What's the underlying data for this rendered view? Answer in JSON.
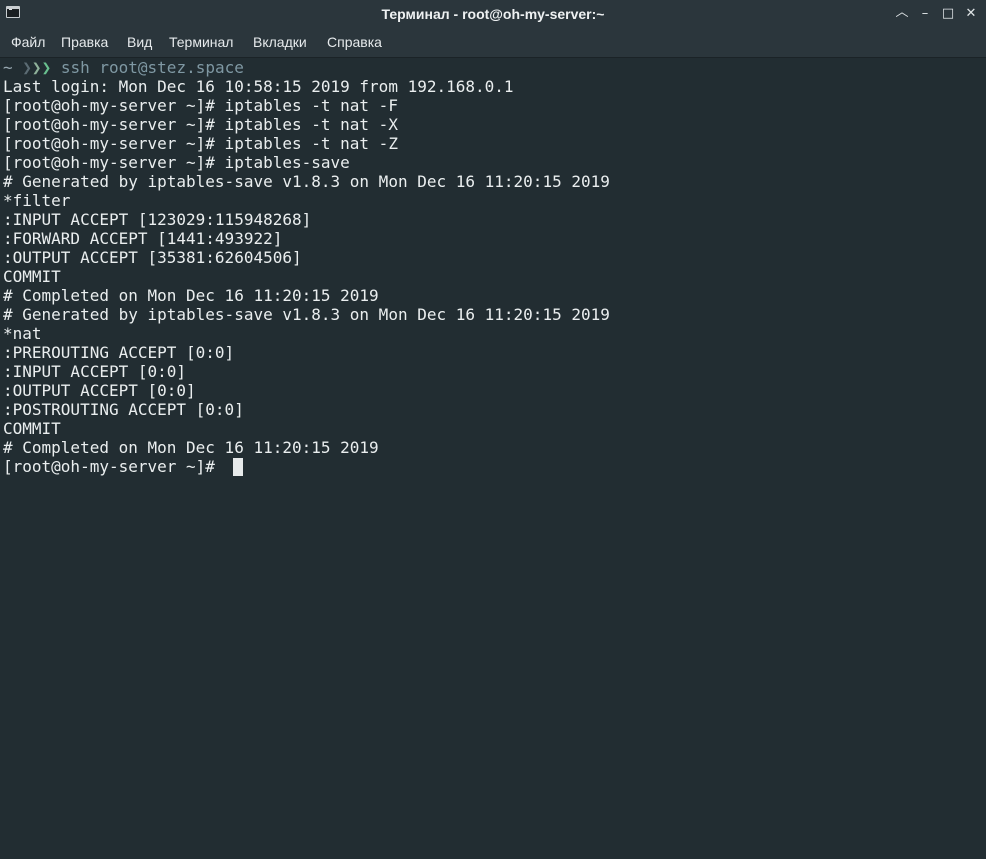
{
  "window": {
    "title": "Терминал - root@oh-my-server:~",
    "controls": {
      "chevron_up_icon": "︿",
      "minimize_icon": "–",
      "maximize_icon": "□",
      "close_icon": "✕"
    }
  },
  "menu": {
    "items": [
      "Файл",
      "Правка",
      "Вид",
      "Терминал",
      "Вкладки",
      "Справка"
    ]
  },
  "terminal": {
    "ssh_prompt": {
      "tilde": "~",
      "arrow1": "❯",
      "arrow2": "❯",
      "arrow3": "❯",
      "command": "ssh root@stez.space"
    },
    "lines": [
      "Last login: Mon Dec 16 10:58:15 2019 from 192.168.0.1",
      "[root@oh-my-server ~]# iptables -t nat -F",
      "[root@oh-my-server ~]# iptables -t nat -X",
      "[root@oh-my-server ~]# iptables -t nat -Z",
      "[root@oh-my-server ~]# iptables-save",
      "# Generated by iptables-save v1.8.3 on Mon Dec 16 11:20:15 2019",
      "*filter",
      ":INPUT ACCEPT [123029:115948268]",
      ":FORWARD ACCEPT [1441:493922]",
      ":OUTPUT ACCEPT [35381:62604506]",
      "COMMIT",
      "# Completed on Mon Dec 16 11:20:15 2019",
      "# Generated by iptables-save v1.8.3 on Mon Dec 16 11:20:15 2019",
      "*nat",
      ":PREROUTING ACCEPT [0:0]",
      ":INPUT ACCEPT [0:0]",
      ":OUTPUT ACCEPT [0:0]",
      ":POSTROUTING ACCEPT [0:0]",
      "COMMIT",
      "# Completed on Mon Dec 16 11:20:15 2019",
      "[root@oh-my-server ~]# "
    ]
  }
}
